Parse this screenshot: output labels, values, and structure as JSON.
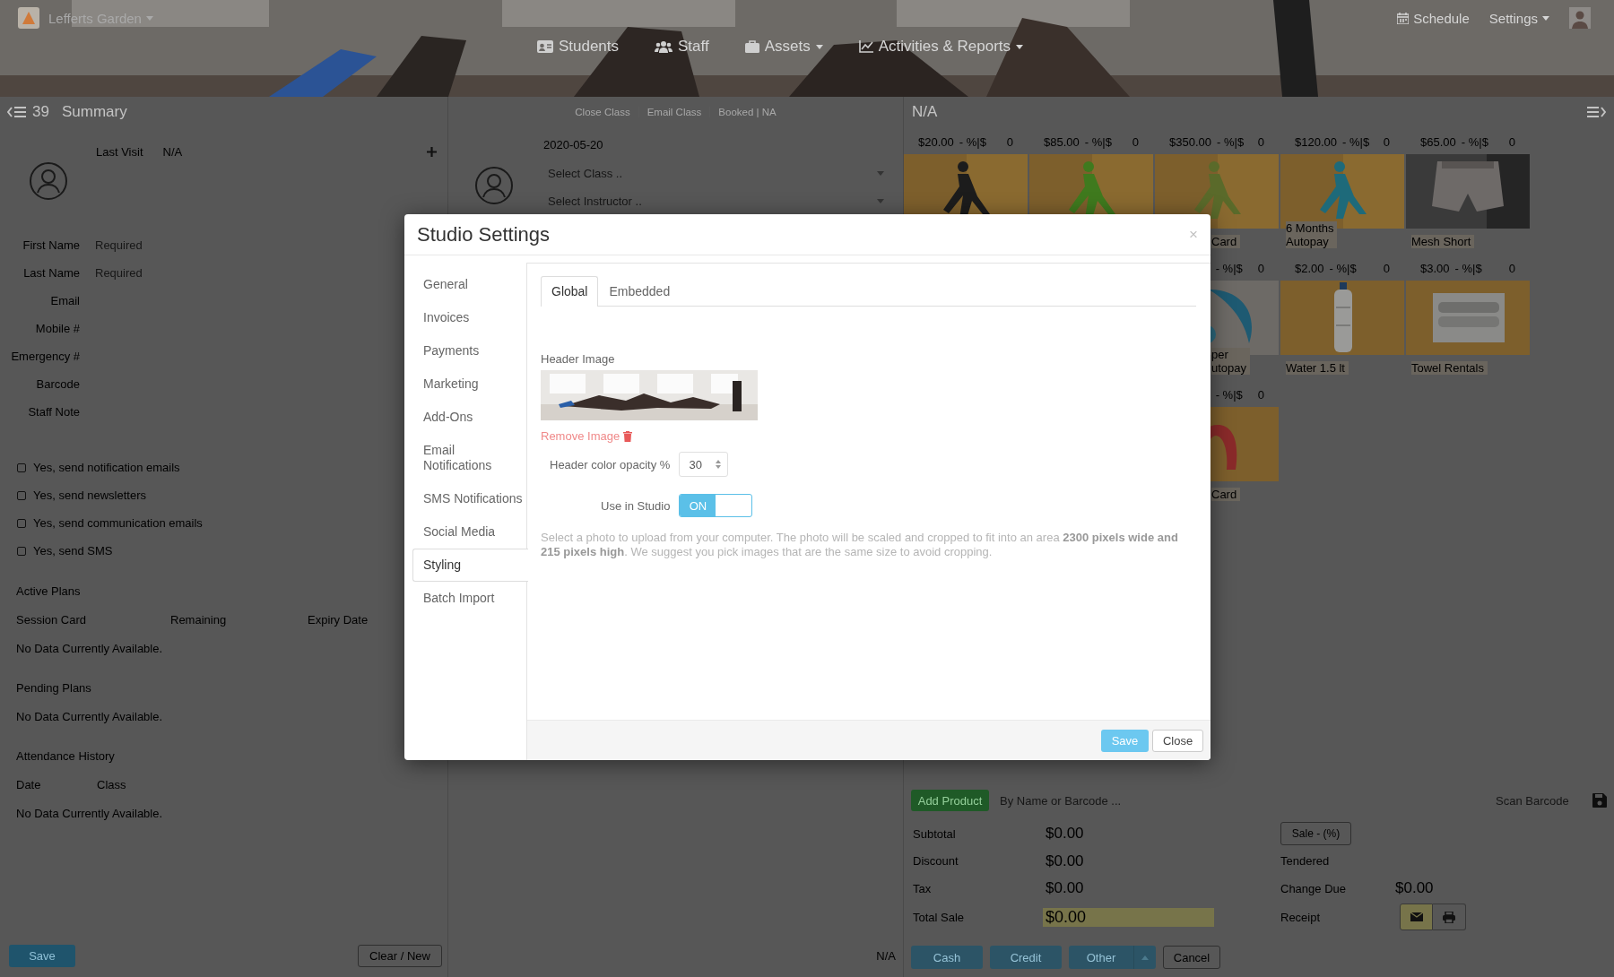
{
  "topbar": {
    "brand": {
      "label": "Lefferts Garden",
      "dropdown": true
    },
    "schedule": "Schedule",
    "settings": {
      "label": "Settings",
      "dropdown": true
    }
  },
  "nav": [
    {
      "label": "Students",
      "dropdown": false
    },
    {
      "label": "Staff",
      "dropdown": false
    },
    {
      "label": "Assets",
      "dropdown": true
    },
    {
      "label": "Activities & Reports",
      "dropdown": true
    }
  ],
  "summary": {
    "count": "39",
    "title": "Summary",
    "last_visit_label": "Last Visit",
    "last_visit": "N/A",
    "fields": [
      {
        "label": "First Name",
        "placeholder": "Required"
      },
      {
        "label": "Last Name",
        "placeholder": "Required"
      },
      {
        "label": "Email"
      },
      {
        "label": "Mobile #"
      },
      {
        "label": "Emergency #"
      },
      {
        "label": "Barcode"
      },
      {
        "label": "Staff Note"
      }
    ],
    "options": [
      {
        "label": "Yes, send notification emails",
        "checked": false
      },
      {
        "label": "Yes, send newsletters",
        "checked": false
      },
      {
        "label": "Yes, send communication emails",
        "checked": false
      },
      {
        "label": "Yes, send SMS",
        "checked": false
      }
    ],
    "active_plans": {
      "title": "Active Plans",
      "columns": [
        "Session Card",
        "Remaining",
        "Expiry Date"
      ],
      "empty": "No Data Currently Available."
    },
    "pending_plans": {
      "title": "Pending Plans",
      "empty": "No Data Currently Available."
    },
    "attendance": {
      "title": "Attendance History",
      "columns": [
        "Date",
        "Class"
      ],
      "empty": "No Data Currently Available."
    },
    "save": "Save",
    "clear": "Clear / New"
  },
  "class_panel": {
    "actions": [
      "Close Class",
      "Email Class",
      "Booked | NA"
    ],
    "date": "2020-05-20",
    "class_select": {
      "placeholder": "Select Class .."
    },
    "instructor_select": {
      "placeholder": "Select Instructor .."
    },
    "footer": "N/A"
  },
  "pos": {
    "title": "N/A",
    "product_rows": [
      [
        {
          "price": "$20.00",
          "discount": "- %|$",
          "qty": "0"
        },
        {
          "price": "$85.00",
          "discount": "- %|$",
          "qty": "0"
        },
        {
          "price": "$350.00",
          "discount": "- %|$",
          "qty": "0",
          "name": "Card",
          "clipped": true
        },
        {
          "price": "$120.00",
          "discount": "- %|$",
          "qty": "0",
          "name": "6 Months\nAutopay",
          "clipped": false
        },
        {
          "price": "$65.00",
          "discount": "- %|$",
          "qty": "0",
          "name": "Mesh Short",
          "clipped": false
        }
      ],
      [
        {
          "discount": "- %|$",
          "qty": "0",
          "name": "per\nutopay",
          "clipped": true
        },
        {
          "price": "$2.00",
          "discount": "- %|$",
          "qty": "0",
          "name": "Water 1.5 lt",
          "clipped": false
        },
        {
          "price": "$3.00",
          "discount": "- %|$",
          "qty": "0",
          "name": "Towel Rentals",
          "clipped": false
        }
      ],
      [
        {
          "discount": "- %|$",
          "qty": "0",
          "name": "Card",
          "clipped": true
        }
      ]
    ],
    "add_product": "Add Product",
    "search_placeholder": "By Name or Barcode ...",
    "barcode_placeholder": "Scan Barcode",
    "totals": [
      {
        "label": "Subtotal",
        "value": "$0.00",
        "highlight": false
      },
      {
        "label": "Discount",
        "value": "$0.00",
        "highlight": false
      },
      {
        "label": "Tax",
        "value": "$0.00",
        "highlight": false
      },
      {
        "label": "Total Sale",
        "value": "$0.00",
        "highlight": true
      }
    ],
    "sale_button": "Sale - (%)",
    "tendered": "Tendered",
    "change_due": {
      "label": "Change Due",
      "value": "$0.00"
    },
    "receipt": {
      "label": "Receipt",
      "options": [
        {
          "kind": "email",
          "selected": true
        },
        {
          "kind": "print",
          "selected": false
        }
      ]
    },
    "payments": [
      {
        "label": "Cash",
        "split": false
      },
      {
        "label": "Credit",
        "split": false
      },
      {
        "label": "Other",
        "split": true
      }
    ],
    "cancel": "Cancel"
  },
  "modal": {
    "title": "Studio Settings",
    "close": "×",
    "menu": [
      {
        "label": "General",
        "selected": false
      },
      {
        "label": "Invoices",
        "selected": false
      },
      {
        "label": "Payments",
        "selected": false
      },
      {
        "label": "Marketing",
        "selected": false
      },
      {
        "label": "Add-Ons",
        "selected": false
      },
      {
        "label": "Email Notifications",
        "selected": false
      },
      {
        "label": "SMS Notifications",
        "selected": false
      },
      {
        "label": "Social Media",
        "selected": false
      },
      {
        "label": "Styling",
        "selected": true
      },
      {
        "label": "Batch Import",
        "selected": false
      }
    ],
    "tabs": [
      {
        "label": "Global",
        "selected": true
      },
      {
        "label": "Embedded",
        "selected": false
      }
    ],
    "header_image_label": "Header Image",
    "remove_image": "Remove Image",
    "opacity": {
      "label": "Header color opacity %",
      "value": "30"
    },
    "use_in_studio": {
      "label": "Use in Studio",
      "on": true,
      "on_text": "ON"
    },
    "help": "Select a photo to upload from your computer. The photo will be scaled and cropped to fit into an area **2300 pixels wide and 215 pixels high**. We suggest you pick images that are the same size to avoid cropping.",
    "save": "Save",
    "close_button": "Close"
  }
}
